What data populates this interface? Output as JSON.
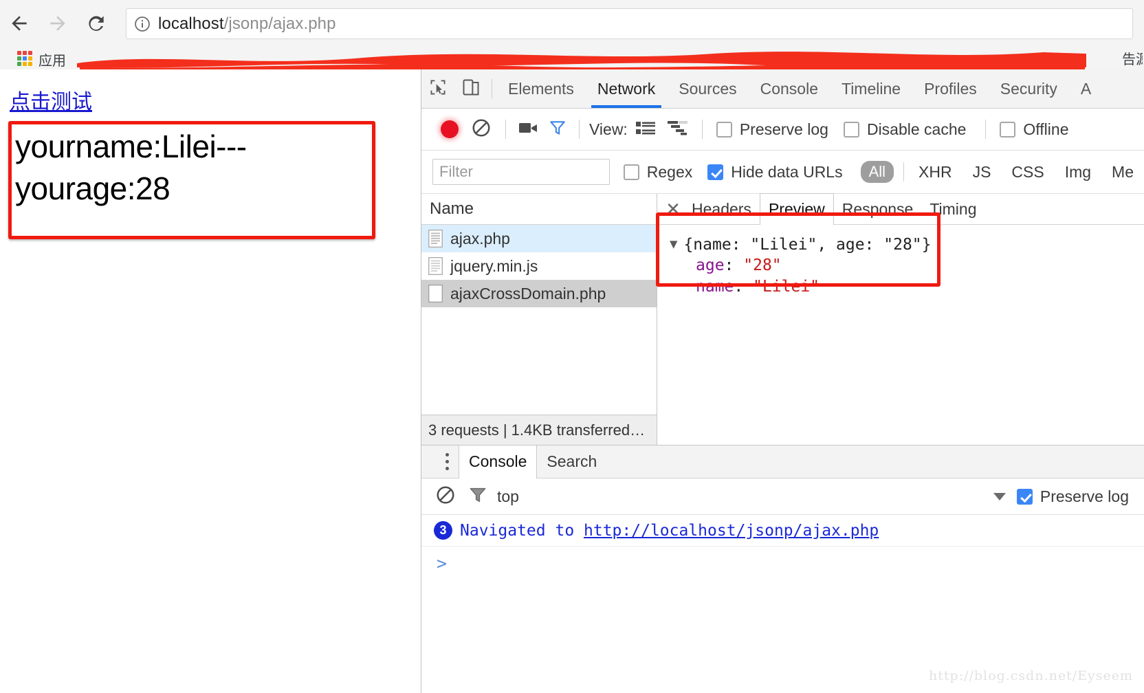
{
  "browser": {
    "back_icon": "arrow-left-icon",
    "forward_icon": "arrow-right-icon",
    "reload_icon": "reload-icon",
    "info_icon": "info-circle-icon",
    "url_host": "localhost",
    "url_path": "/jsonp/ajax.php",
    "bookmarks": {
      "apps_label": "应用",
      "apps_icon": "apps-grid-icon",
      "right_partial_label": "告源",
      "redaction_color": "#f42e1c"
    }
  },
  "page": {
    "link_label": "点击测试",
    "result_line1": "yourname:Lilei---",
    "result_line2": "yourage:28",
    "annotation_color": "#f01a10"
  },
  "devtools": {
    "inspect_icon": "inspect-cursor-icon",
    "device_icon": "device-toolbar-icon",
    "tabs": [
      {
        "label": "Elements",
        "active": false
      },
      {
        "label": "Network",
        "active": true
      },
      {
        "label": "Sources",
        "active": false
      },
      {
        "label": "Console",
        "active": false
      },
      {
        "label": "Timeline",
        "active": false
      },
      {
        "label": "Profiles",
        "active": false
      },
      {
        "label": "Security",
        "active": false
      },
      {
        "label": "A",
        "active": false
      }
    ],
    "network_toolbar": {
      "record_icon": "record-button-icon",
      "clear_icon": "clear-no-entry-icon",
      "camera_icon": "film-camera-icon",
      "funnel_icon": "filter-funnel-icon",
      "view_label": "View:",
      "view_list_icon": "list-view-icon",
      "view_waterfall_icon": "waterfall-view-icon",
      "preserve_log_label": "Preserve log",
      "preserve_log_checked": false,
      "disable_cache_label": "Disable cache",
      "disable_cache_checked": false,
      "offline_label": "Offline",
      "offline_checked": false
    },
    "filter_bar": {
      "filter_placeholder": "Filter",
      "filter_value": "",
      "regex_label": "Regex",
      "regex_checked": false,
      "hide_data_urls_label": "Hide data URLs",
      "hide_data_urls_checked": true,
      "types": [
        "All",
        "XHR",
        "JS",
        "CSS",
        "Img",
        "Me"
      ],
      "active_type": "All"
    },
    "requests": {
      "column_header": "Name",
      "rows": [
        {
          "name": "ajax.php",
          "state": "selected",
          "icon": "document-icon"
        },
        {
          "name": "jquery.min.js",
          "state": "normal",
          "icon": "document-icon"
        },
        {
          "name": "ajaxCrossDomain.php",
          "state": "hovered",
          "icon": "blank-document-icon"
        }
      ],
      "status": "3 requests | 1.4KB transferred…"
    },
    "detail": {
      "close_icon": "close-icon",
      "tabs": [
        {
          "label": "Headers",
          "active": false
        },
        {
          "label": "Preview",
          "active": true
        },
        {
          "label": "Response",
          "active": false
        },
        {
          "label": "Timing",
          "active": false
        }
      ],
      "preview": {
        "triangle_icon": "triangle-down-icon",
        "summary": "{name: \"Lilei\", age: \"28\"}",
        "entries": [
          {
            "key": "age",
            "value": "\"28\""
          },
          {
            "key": "name",
            "value": "\"Lilei\""
          }
        ],
        "key_color": "#881391",
        "string_color": "#c41a16"
      }
    },
    "drawer": {
      "kebab_icon": "more-vertical-icon",
      "tabs": [
        {
          "label": "Console",
          "active": true
        },
        {
          "label": "Search",
          "active": false
        }
      ],
      "console_toolbar": {
        "clear_icon": "clear-no-entry-icon",
        "filter_icon": "filter-funnel-icon",
        "context": "top",
        "caret_icon": "caret-down-icon",
        "preserve_log_label": "Preserve log",
        "preserve_log_checked": true
      },
      "messages": [
        {
          "count": "3",
          "text": "Navigated to ",
          "link": "http://localhost/jsonp/ajax.php"
        }
      ],
      "prompt_symbol": ">"
    }
  },
  "watermark": "http://blog.csdn.net/Eyseem"
}
